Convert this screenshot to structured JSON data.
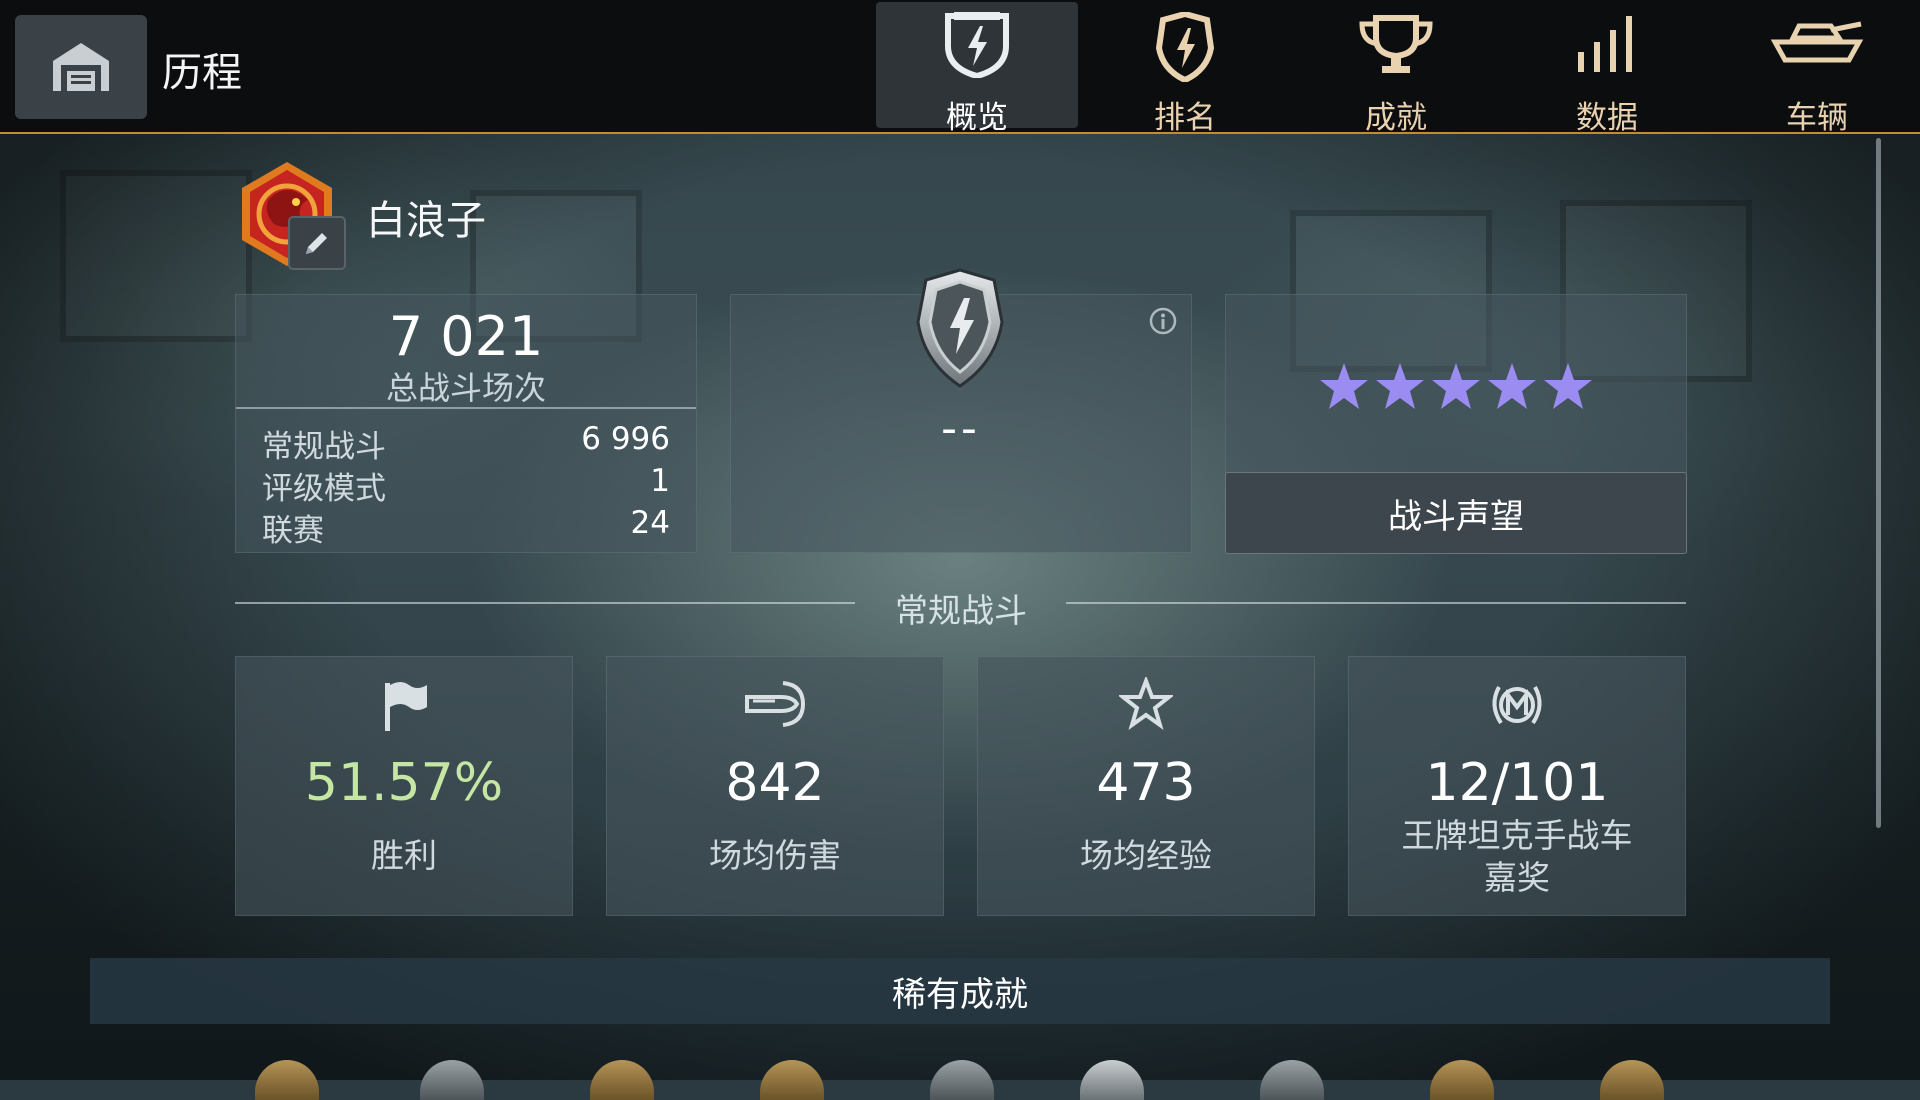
{
  "header": {
    "title": "历程",
    "tabs": [
      {
        "label": "概览",
        "icon": "shield-bolt-icon",
        "active": true
      },
      {
        "label": "排名",
        "icon": "rank-badge-icon",
        "active": false
      },
      {
        "label": "成就",
        "icon": "trophy-icon",
        "active": false
      },
      {
        "label": "数据",
        "icon": "bar-chart-icon",
        "active": false
      },
      {
        "label": "车辆",
        "icon": "tank-icon",
        "active": false
      }
    ]
  },
  "profile": {
    "name": "白浪子"
  },
  "battles": {
    "total": "7 021",
    "total_label": "总战斗场次",
    "rows": [
      {
        "label": "常规战斗",
        "value": "6 996"
      },
      {
        "label": "评级模式",
        "value": "1"
      },
      {
        "label": "联赛",
        "value": "24"
      }
    ]
  },
  "rating": {
    "value": "--"
  },
  "reputation": {
    "stars": 5,
    "star_color": "#9b8cf2",
    "button_label": "战斗声望"
  },
  "regular": {
    "section_title": "常规战斗",
    "stats": [
      {
        "icon": "flag-icon",
        "value": "51.57%",
        "label": "胜利",
        "value_color": "#c6e6a4"
      },
      {
        "icon": "damage-shell-icon",
        "value": "842",
        "label": "场均伤害",
        "value_color": "#ffffff"
      },
      {
        "icon": "star-outline-icon",
        "value": "473",
        "label": "场均经验",
        "value_color": "#ffffff"
      },
      {
        "icon": "mastery-badge-icon",
        "value": "12/101",
        "label_line1": "王牌坦克手战车",
        "label_line2": "嘉奖",
        "value_color": "#ffffff"
      }
    ]
  },
  "rare": {
    "title": "稀有成就"
  },
  "colors": {
    "accent_border": "#c98a2b",
    "topbar": "#0b0d0e"
  }
}
